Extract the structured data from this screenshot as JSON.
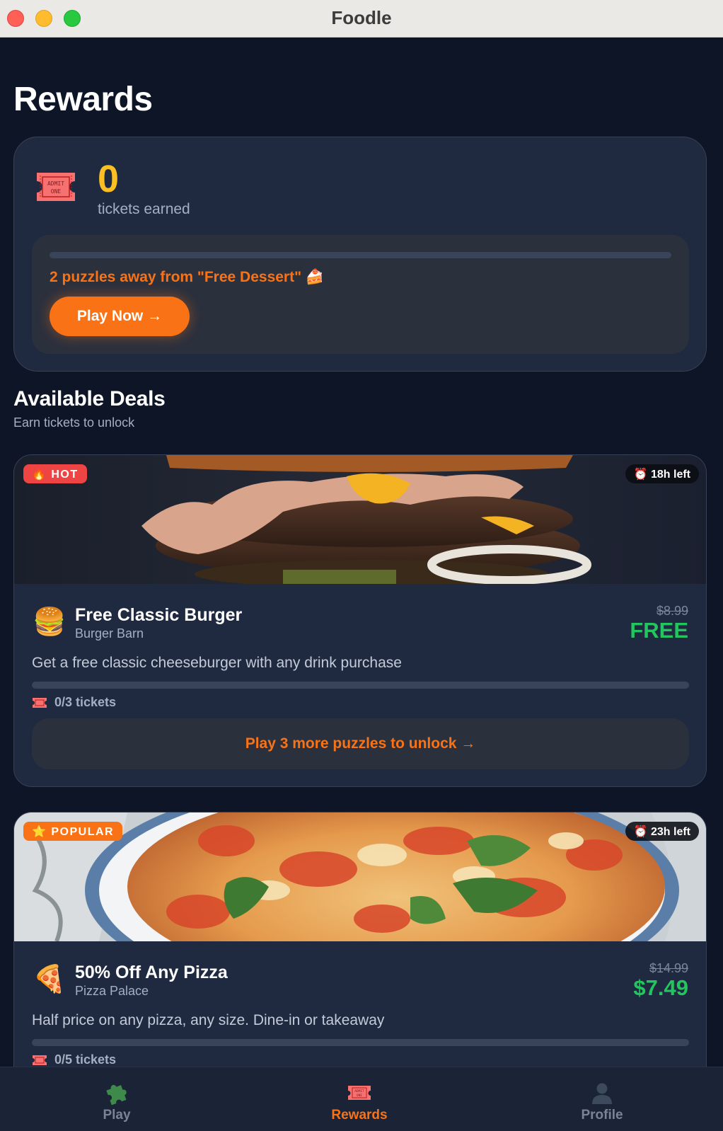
{
  "window": {
    "title": "Foodle"
  },
  "page": {
    "title": "Rewards"
  },
  "tickets": {
    "count": "0",
    "label": "tickets earned",
    "progress": 0,
    "message": "2 puzzles away from \"Free Dessert\" 🍰",
    "play_now_label": "Play Now →",
    "icon": "admit-one-ticket-icon"
  },
  "deals_section": {
    "title": "Available Deals",
    "subtitle": "Earn tickets to unlock"
  },
  "deals": [
    {
      "badge": "🔥 HOT",
      "time_left": "⏰ 18h left",
      "emoji": "🍔",
      "name": "Free Classic Burger",
      "place": "Burger Barn",
      "original_price": "$8.99",
      "price": "FREE",
      "description": "Get a free classic cheeseburger with any drink purchase",
      "progress": 0,
      "tickets": "0/3 tickets",
      "unlock_label": "Play 3 more puzzles to unlock →"
    },
    {
      "badge": "⭐ POPULAR",
      "time_left": "⏰ 23h left",
      "emoji": "🍕",
      "name": "50% Off Any Pizza",
      "place": "Pizza Palace",
      "original_price": "$14.99",
      "price": "$7.49",
      "description": "Half price on any pizza, any size. Dine-in or takeaway",
      "progress": 0,
      "tickets": "0/5 tickets",
      "unlock_label": ""
    }
  ],
  "tabs": [
    {
      "label": "Play",
      "icon": "puzzle-icon"
    },
    {
      "label": "Rewards",
      "icon": "ticket-icon",
      "active": true
    },
    {
      "label": "Profile",
      "icon": "person-icon"
    }
  ],
  "colors": {
    "background": "#0e1527",
    "card": "#1f2940",
    "accent": "#f97316",
    "gold": "#fbbf24",
    "green": "#22c55e",
    "hot": "#ef4444"
  }
}
